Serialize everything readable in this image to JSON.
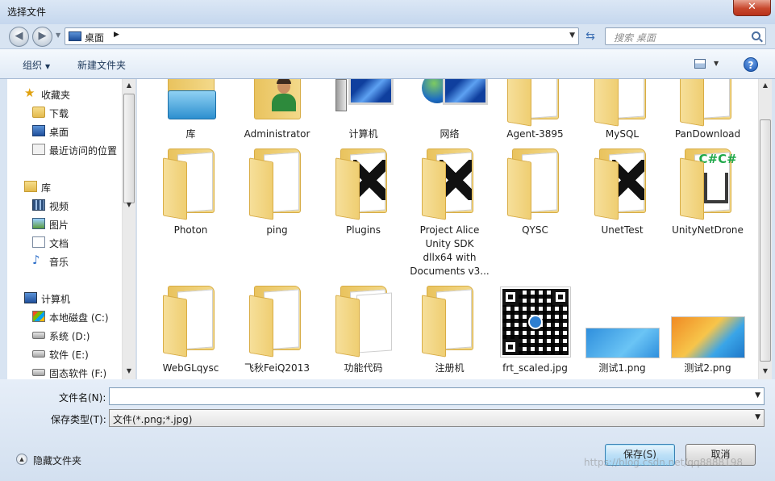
{
  "window": {
    "title": "选择文件",
    "close_glyph": "✕"
  },
  "nav": {
    "back_glyph": "◀",
    "forward_glyph": "▶",
    "history_glyph": "▼"
  },
  "address": {
    "location": "桌面",
    "chevron": "▶",
    "dropdown": "▼",
    "refresh_glyph": "⇆"
  },
  "search": {
    "placeholder": "搜索 桌面"
  },
  "toolbar": {
    "organize": "组织",
    "organize_caret": "▼",
    "new_folder": "新建文件夹",
    "view_caret": "▼",
    "help": "?"
  },
  "sidebar": {
    "favorites": {
      "label": "收藏夹",
      "items": [
        "下载",
        "桌面",
        "最近访问的位置"
      ]
    },
    "libraries": {
      "label": "库",
      "items": [
        "视频",
        "图片",
        "文档",
        "音乐"
      ]
    },
    "computer": {
      "label": "计算机",
      "items": [
        "本地磁盘 (C:)",
        "系统 (D:)",
        "软件 (E:)",
        "固态软件 (F:)"
      ]
    }
  },
  "files": [
    {
      "name": "库",
      "type": "library"
    },
    {
      "name": "Administrator",
      "type": "user"
    },
    {
      "name": "计算机",
      "type": "computer"
    },
    {
      "name": "网络",
      "type": "network"
    },
    {
      "name": "Agent-3895",
      "type": "folder"
    },
    {
      "name": "MySQL",
      "type": "folder"
    },
    {
      "name": "PanDownload",
      "type": "folder"
    },
    {
      "name": "Photon",
      "type": "folder"
    },
    {
      "name": "ping",
      "type": "folder"
    },
    {
      "name": "Plugins",
      "type": "unity-folder"
    },
    {
      "name": "Project Alice\nUnity SDK\ndllx64  with\nDocuments v3...",
      "type": "unity-folder"
    },
    {
      "name": "QYSC",
      "type": "folder"
    },
    {
      "name": "UnetTest",
      "type": "unity-folder"
    },
    {
      "name": "UnityNetDrone",
      "type": "csharp-folder"
    },
    {
      "name": "WebGLqysc",
      "type": "folder"
    },
    {
      "name": "飞秋FeiQ2013",
      "type": "folder"
    },
    {
      "name": "功能代码",
      "type": "folder"
    },
    {
      "name": "注册机",
      "type": "folder"
    },
    {
      "name": "frt_scaled.jpg",
      "type": "qr-image"
    },
    {
      "name": "测试1.png",
      "type": "screenshot-blue"
    },
    {
      "name": "测试2.png",
      "type": "screenshot-orange"
    }
  ],
  "form": {
    "filename_label": "文件名(N):",
    "filename_value": "",
    "filetype_label": "保存类型(T):",
    "filetype_value": "文件(*.png;*.jpg)",
    "hide_folders": "隐藏文件夹",
    "save": "保存(S)",
    "cancel": "取消"
  },
  "scroll": {
    "up": "▲",
    "down": "▼"
  },
  "watermark": "https://blog.csdn.net/qq8888198",
  "colors": {
    "accent": "#3c7fb1",
    "folder": "#efce72",
    "close": "#c8482d"
  }
}
